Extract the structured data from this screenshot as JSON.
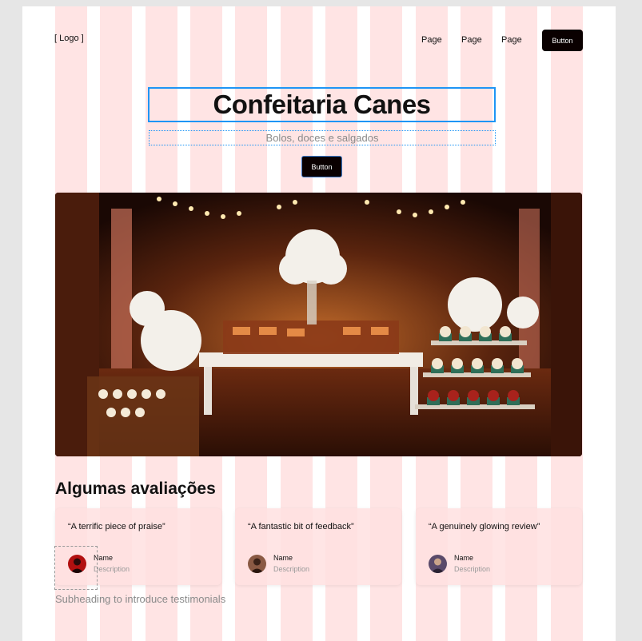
{
  "header": {
    "logo": "[ Logo ]",
    "nav": [
      {
        "label": "Page"
      },
      {
        "label": "Page"
      },
      {
        "label": "Page"
      }
    ],
    "button_label": "Button"
  },
  "hero": {
    "title": "Confeitaria Canes",
    "subtitle": "Bolos, doces e salgados",
    "button_label": "Button"
  },
  "testimonials": {
    "title": "Algumas avaliações",
    "subheading": "Subheading to introduce testimonials",
    "cards": [
      {
        "quote": "“A terrific piece of praise”",
        "name": "Name",
        "description": "Description"
      },
      {
        "quote": "“A fantastic bit of feedback”",
        "name": "Name",
        "description": "Description"
      },
      {
        "quote": "“A genuinely glowing review”",
        "name": "Name",
        "description": "Description"
      }
    ]
  },
  "colors": {
    "button_bg": "#0a0000",
    "selection_blue": "#1e95f5",
    "grid_overlay": "#ffd6d6"
  }
}
